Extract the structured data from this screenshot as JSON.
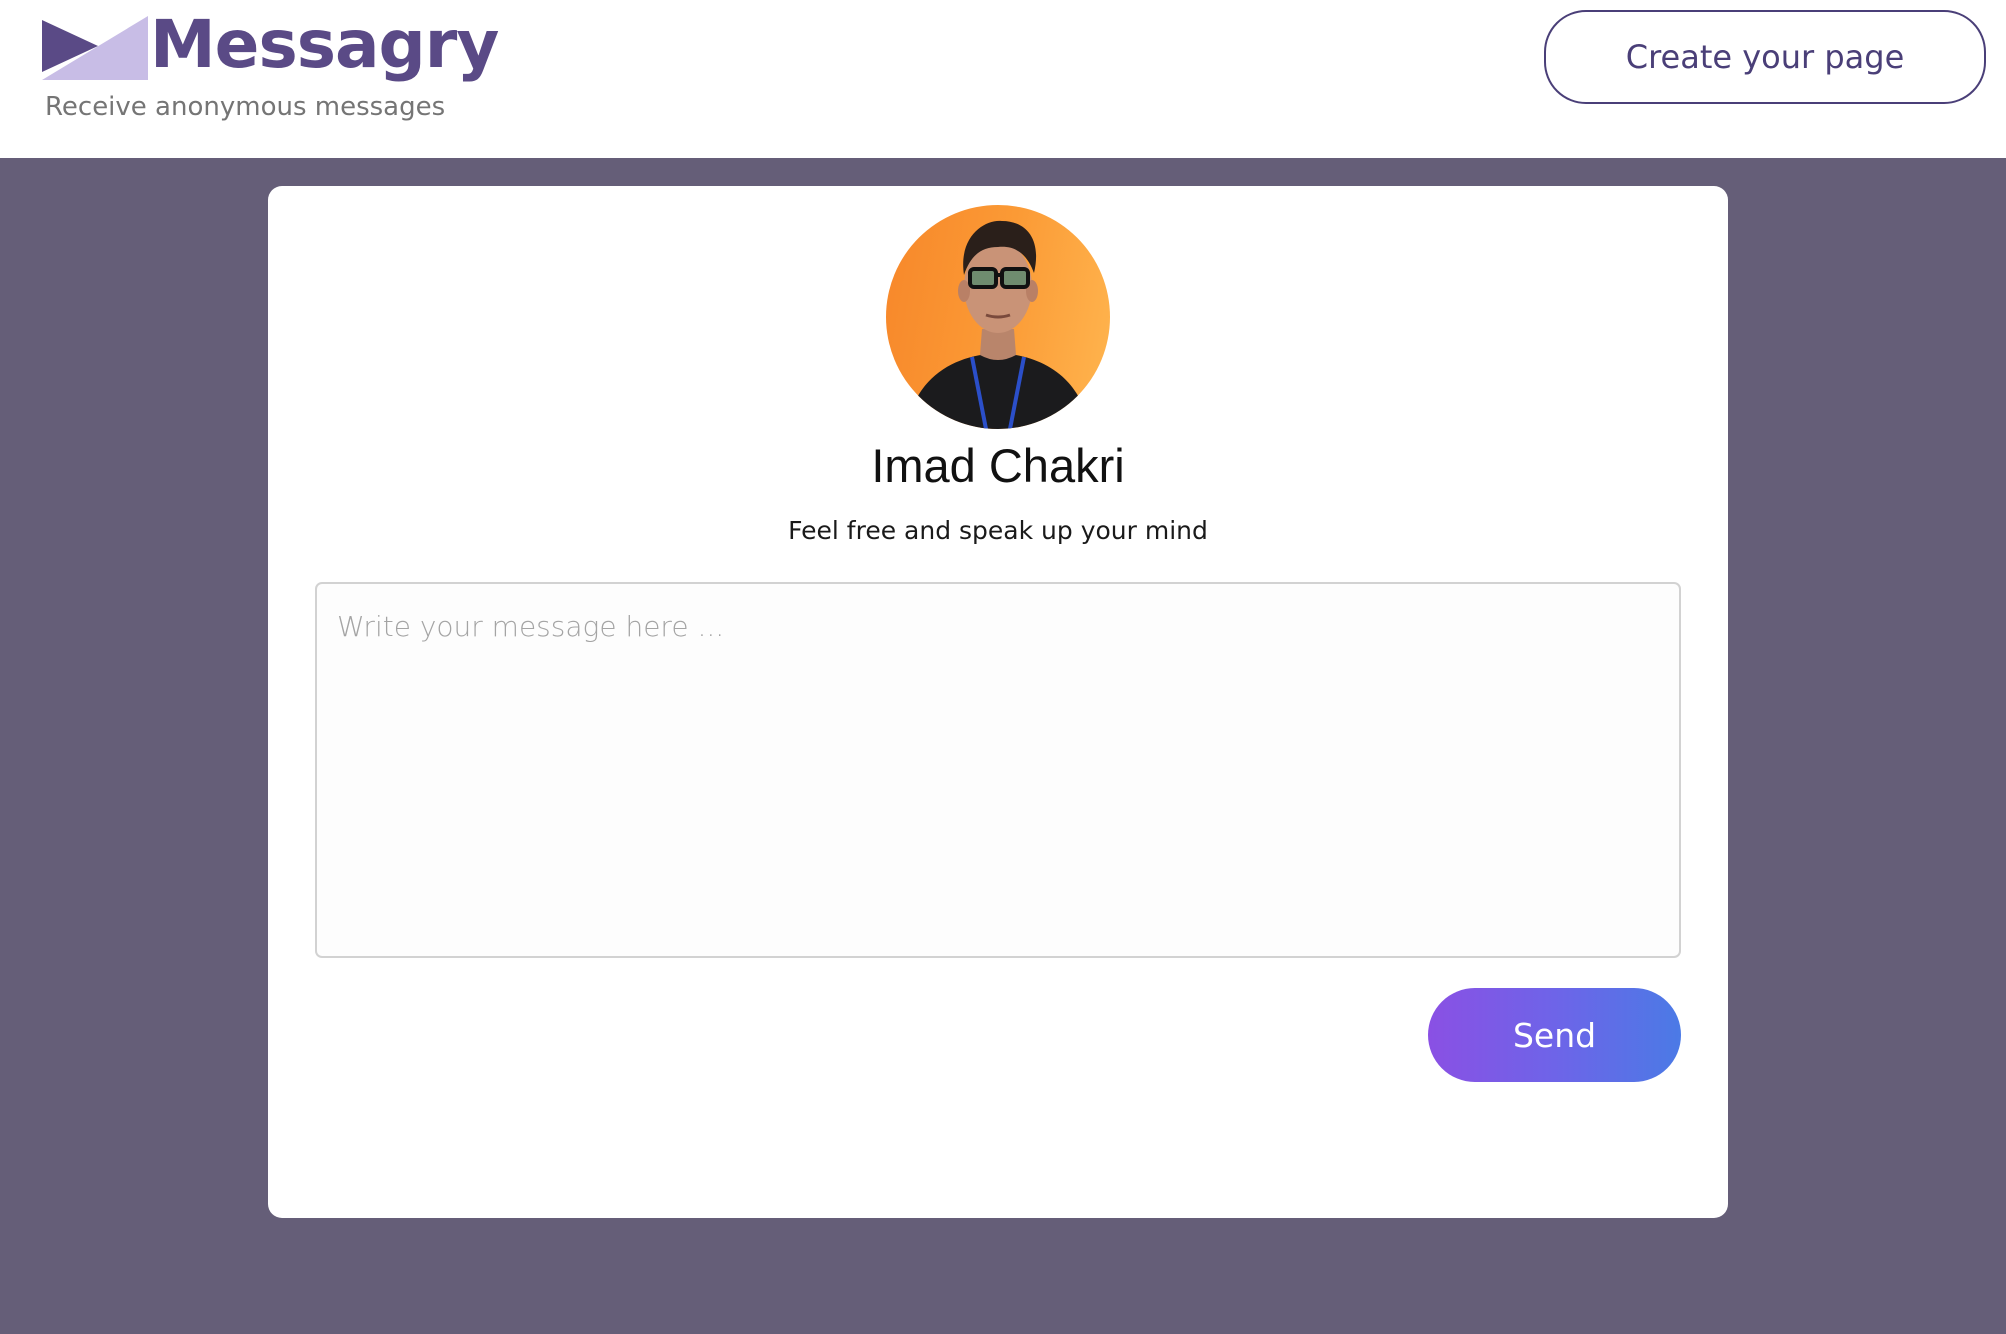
{
  "brand": {
    "name": "Messagry",
    "tagline": "Receive anonymous messages",
    "colors": {
      "primary": "#5a4a86",
      "light": "#c8bde6"
    }
  },
  "header": {
    "create_button_label": "Create your page"
  },
  "profile": {
    "name": "Imad Chakri",
    "bio": "Feel free and speak up your mind",
    "avatar": "profile-photo"
  },
  "message_form": {
    "placeholder": "Write your message here ...",
    "value": "",
    "send_label": "Send"
  },
  "colors": {
    "page_background": "#655e78",
    "send_gradient_start": "#8a50e4",
    "send_gradient_end": "#4b7ae6"
  }
}
